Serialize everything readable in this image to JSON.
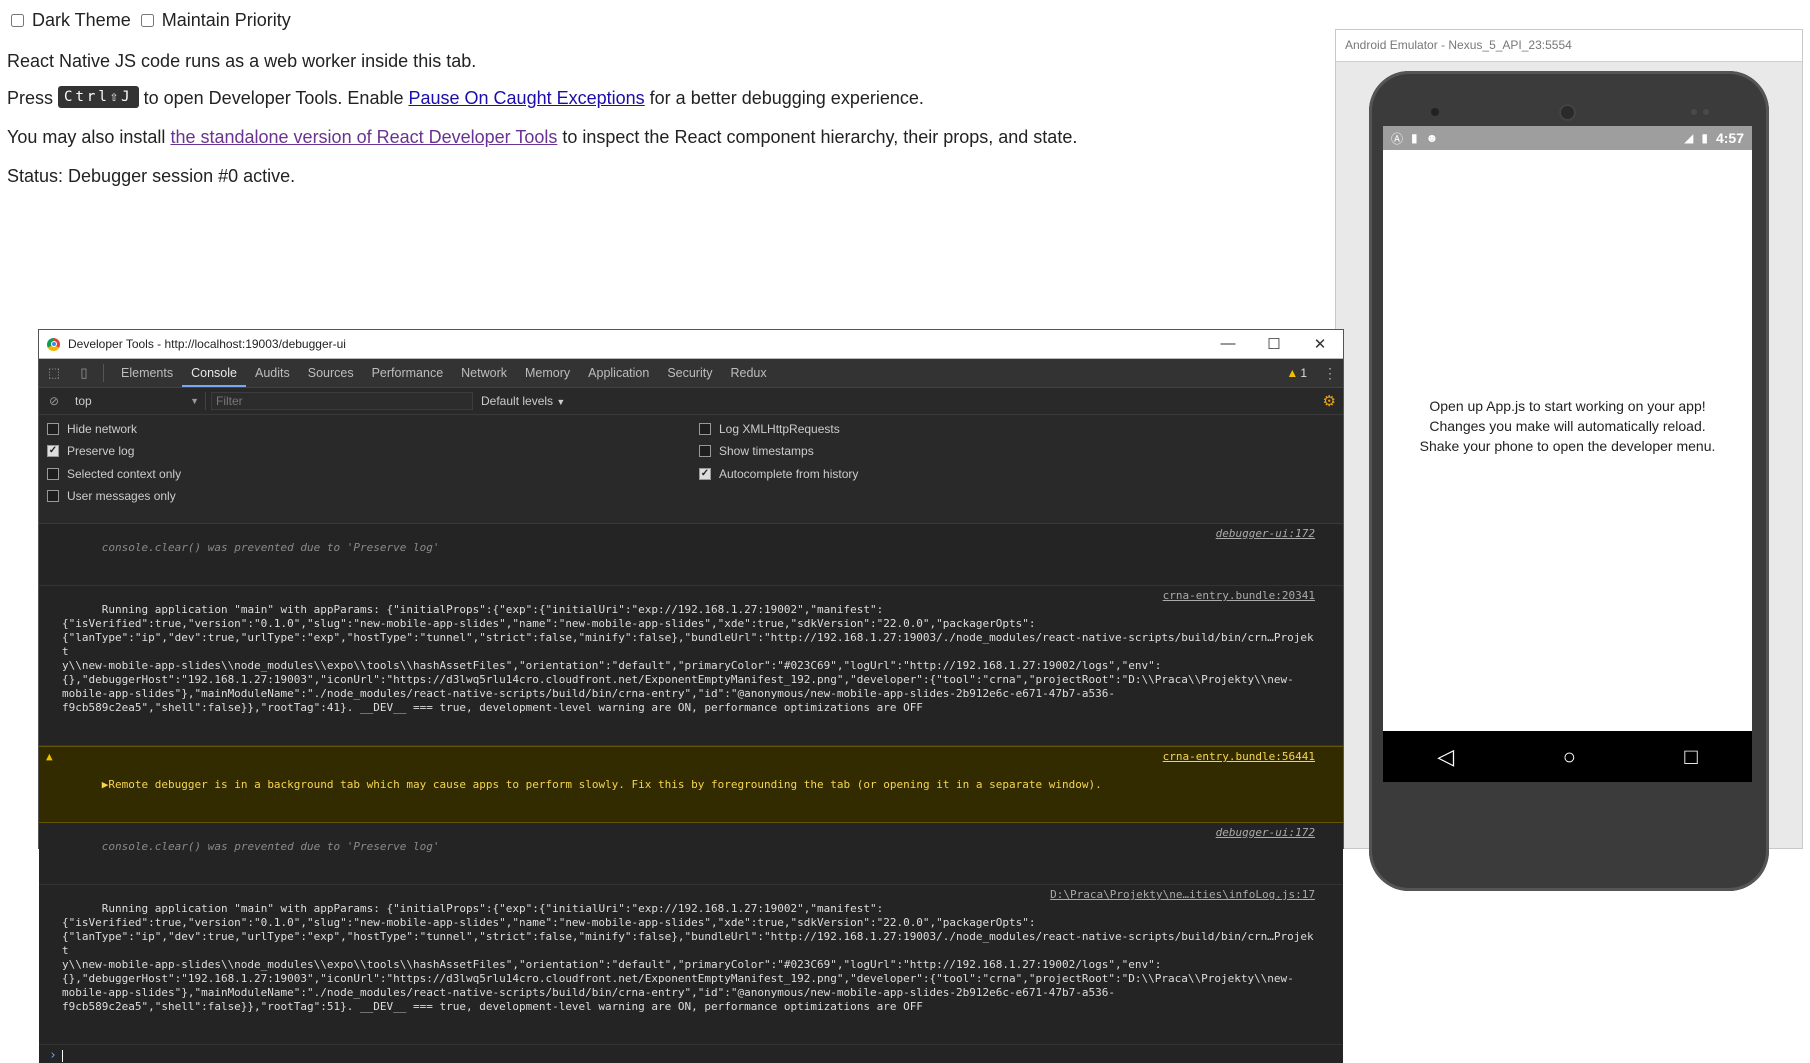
{
  "debugger_page": {
    "dark_theme_label": "Dark Theme",
    "maintain_priority_label": "Maintain Priority",
    "line_webworker": "React Native JS code runs as a web worker inside this tab.",
    "press_prefix": "Press",
    "kbd_shortcut": "Ctrl⇧J",
    "press_middle": "to open Developer Tools. Enable",
    "pause_link": "Pause On Caught Exceptions",
    "press_suffix": "for a better debugging experience.",
    "install_prefix": "You may also install",
    "devtools_link": "the standalone version of React Developer Tools",
    "install_suffix": "to inspect the React component hierarchy, their props, and state.",
    "status": "Status: Debugger session #0 active."
  },
  "emulator": {
    "window_title": "Android Emulator - Nexus_5_API_23:5554",
    "time": "4:57",
    "app_lines": [
      "Open up App.js to start working on your app!",
      "Changes you make will automatically reload.",
      "Shake your phone to open the developer menu."
    ],
    "nav": {
      "back": "◁",
      "home": "○",
      "recents": "□"
    }
  },
  "devtools": {
    "window_title": "Developer Tools - http://localhost:19003/debugger-ui",
    "win_buttons": {
      "minimize": "—",
      "maximize": "☐",
      "close": "✕"
    },
    "tabs": [
      "Elements",
      "Console",
      "Audits",
      "Sources",
      "Performance",
      "Network",
      "Memory",
      "Application",
      "Security",
      "Redux"
    ],
    "active_tab": "Console",
    "warning_count": "1",
    "context": "top",
    "filter_placeholder": "Filter",
    "levels": "Default levels",
    "settings": {
      "hide_network": "Hide network",
      "preserve_log": "Preserve log",
      "selected_context": "Selected context only",
      "user_messages": "User messages only",
      "log_xhr": "Log XMLHttpRequests",
      "show_timestamps": "Show timestamps",
      "autocomplete": "Autocomplete from history"
    },
    "messages": [
      {
        "type": "info",
        "text": "console.clear() was prevented due to 'Preserve log'",
        "source": "debugger-ui:172"
      },
      {
        "type": "log",
        "text": "Running application \"main\" with appParams: {\"initialProps\":{\"exp\":{\"initialUri\":\"exp://192.168.1.27:19002\",\"manifest\":\n{\"isVerified\":true,\"version\":\"0.1.0\",\"slug\":\"new-mobile-app-slides\",\"name\":\"new-mobile-app-slides\",\"xde\":true,\"sdkVersion\":\"22.0.0\",\"packagerOpts\":\n{\"lanType\":\"ip\",\"dev\":true,\"urlType\":\"exp\",\"hostType\":\"tunnel\",\"strict\":false,\"minify\":false},\"bundleUrl\":\"http://192.168.1.27:19003/./node_modules/react-native-scripts/build/bin/crn…Projekt\ny\\\\new-mobile-app-slides\\\\node_modules\\\\expo\\\\tools\\\\hashAssetFiles\",\"orientation\":\"default\",\"primaryColor\":\"#023C69\",\"logUrl\":\"http://192.168.1.27:19002/logs\",\"env\":\n{},\"debuggerHost\":\"192.168.1.27:19003\",\"iconUrl\":\"https://d3lwq5rlu14cro.cloudfront.net/ExponentEmptyManifest_192.png\",\"developer\":{\"tool\":\"crna\",\"projectRoot\":\"D:\\\\Praca\\\\Projekty\\\\new-\nmobile-app-slides\"},\"mainModuleName\":\"./node_modules/react-native-scripts/build/bin/crna-entry\",\"id\":\"@anonymous/new-mobile-app-slides-2b912e6c-e671-47b7-a536-\nf9cb589c2ea5\",\"shell\":false}},\"rootTag\":41}. __DEV__ === true, development-level warning are ON, performance optimizations are OFF",
        "source": "crna-entry.bundle:20341"
      },
      {
        "type": "warn",
        "text": "▶Remote debugger is in a background tab which may cause apps to perform slowly. Fix this by foregrounding the tab (or opening it in a separate window).",
        "source": "crna-entry.bundle:56441"
      },
      {
        "type": "info",
        "text": "console.clear() was prevented due to 'Preserve log'",
        "source": "debugger-ui:172"
      },
      {
        "type": "log",
        "text": "Running application \"main\" with appParams: {\"initialProps\":{\"exp\":{\"initialUri\":\"exp://192.168.1.27:19002\",\"manifest\":\n{\"isVerified\":true,\"version\":\"0.1.0\",\"slug\":\"new-mobile-app-slides\",\"name\":\"new-mobile-app-slides\",\"xde\":true,\"sdkVersion\":\"22.0.0\",\"packagerOpts\":\n{\"lanType\":\"ip\",\"dev\":true,\"urlType\":\"exp\",\"hostType\":\"tunnel\",\"strict\":false,\"minify\":false},\"bundleUrl\":\"http://192.168.1.27:19003/./node_modules/react-native-scripts/build/bin/crn…Projekt\ny\\\\new-mobile-app-slides\\\\node_modules\\\\expo\\\\tools\\\\hashAssetFiles\",\"orientation\":\"default\",\"primaryColor\":\"#023C69\",\"logUrl\":\"http://192.168.1.27:19002/logs\",\"env\":\n{},\"debuggerHost\":\"192.168.1.27:19003\",\"iconUrl\":\"https://d3lwq5rlu14cro.cloudfront.net/ExponentEmptyManifest_192.png\",\"developer\":{\"tool\":\"crna\",\"projectRoot\":\"D:\\\\Praca\\\\Projekty\\\\new-\nmobile-app-slides\"},\"mainModuleName\":\"./node_modules/react-native-scripts/build/bin/crna-entry\",\"id\":\"@anonymous/new-mobile-app-slides-2b912e6c-e671-47b7-a536-\nf9cb589c2ea5\",\"shell\":false}},\"rootTag\":51}. __DEV__ === true, development-level warning are ON, performance optimizations are OFF",
        "source": "D:\\Praca\\Projekty\\ne…ities\\infoLog.js:17"
      }
    ],
    "prompt": "›"
  }
}
